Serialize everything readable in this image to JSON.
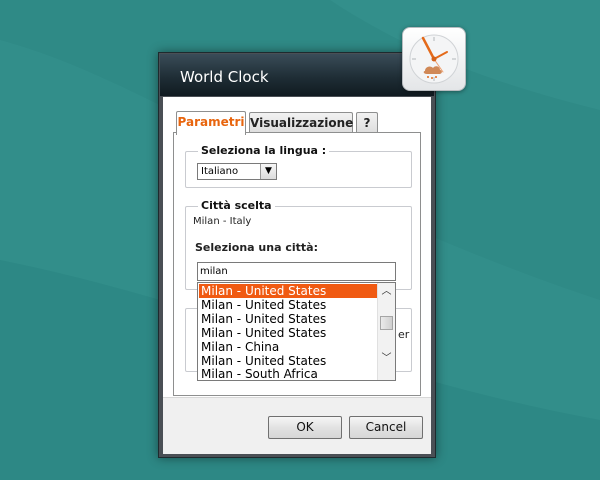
{
  "window": {
    "title": "World Clock"
  },
  "tabs": [
    {
      "label": "Parametri",
      "active": true
    },
    {
      "label": "Visualizzazione",
      "active": false
    },
    {
      "label": "?",
      "active": false
    }
  ],
  "language": {
    "legend": "Seleziona la lingua :",
    "selected": "Italiano"
  },
  "city": {
    "legend": "Città scelta",
    "current": "Milan - Italy",
    "search_label": "Seleziona una città:",
    "search_value": "milan",
    "results": [
      "Milan - United States",
      "Milan - United States",
      "Milan - United States",
      "Milan - United States",
      "Milan - China",
      "Milan - United States",
      "Milan - South Africa"
    ],
    "selected_index": 0
  },
  "hidden_peek": {
    "partial_text": "er"
  },
  "buttons": {
    "ok": "OK",
    "cancel": "Cancel"
  },
  "colors": {
    "accent": "#f05a12",
    "desktop": "#2f8a86",
    "active_tab_text": "#e8650e"
  },
  "icons": {
    "clock": "clock-gadget-icon",
    "dropdown": "chevron-down-icon",
    "scroll_up": "chevron-up-icon",
    "scroll_down": "chevron-down-icon"
  }
}
